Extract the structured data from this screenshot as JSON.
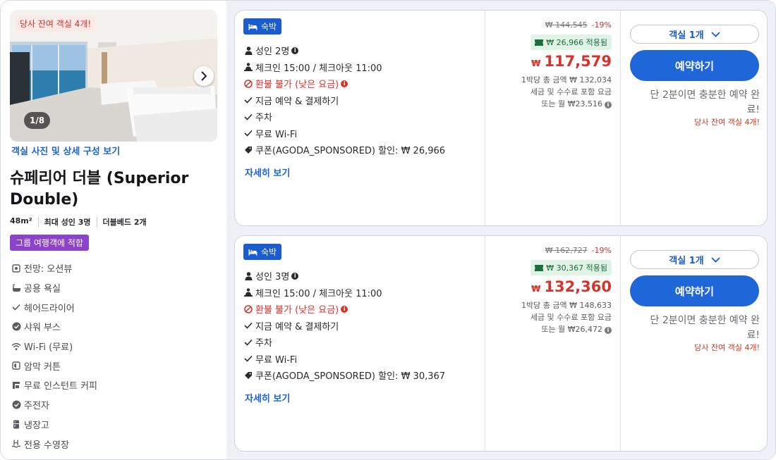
{
  "room": {
    "availability_badge": "당사 잔여 객실 4개!",
    "photo_counter": "1/8",
    "photos_link": "객실 사진 및 상세 구성 보기",
    "title": "슈페리어 더블 (Superior Double)",
    "size": "48m²",
    "max_guests": "최대 성인 3명",
    "beds": "더블베드 2개",
    "group_tag": "그룹 여행객에 적합",
    "amenities": [
      {
        "icon": "view-icon",
        "label": "전망: 오션뷰"
      },
      {
        "icon": "bathtub-icon",
        "label": "공용 욕실"
      },
      {
        "icon": "check-icon",
        "label": "헤어드라이어"
      },
      {
        "icon": "check-circle-icon",
        "label": "샤워 부스"
      },
      {
        "icon": "wifi-icon",
        "label": "Wi-Fi (무료)"
      },
      {
        "icon": "blackout-icon",
        "label": "암막 커튼"
      },
      {
        "icon": "coffee-machine-icon",
        "label": "무료 인스턴트 커피"
      },
      {
        "icon": "check-circle-icon",
        "label": "주전자"
      },
      {
        "icon": "fridge-icon",
        "label": "냉장고"
      },
      {
        "icon": "pool-icon",
        "label": "전용 수영장"
      }
    ]
  },
  "offers": [
    {
      "stay_tag": "숙박",
      "features": {
        "guests": "성인 2명",
        "checkin": "체크인 15:00 / 체크아웃 11:00",
        "refund": "환불 불가 (낮은 요금)",
        "pay_now": "지금 예약 & 결제하기",
        "parking": "주차",
        "wifi": "무료 Wi-Fi",
        "coupon": "쿠폰(AGODA_SPONSORED) 할인: ₩ 26,966"
      },
      "details_link": "자세히 보기",
      "original_price": "₩ 144,545",
      "discount_pct": "-19%",
      "coupon_applied": "₩ 26,966 적용됨",
      "currency": "₩",
      "price": "117,579",
      "total_line": "1박당 총 금액 ₩ 132,034",
      "tax_line": "세금 및 수수료 포함 요금",
      "monthly_line": "또는 월 ₩23,516",
      "room_select": "객실 1개",
      "book_button": "예약하기",
      "booking_note": "단 2분이면 충분한 예약 완료!",
      "availability": "당사 잔여 객실 4개!"
    },
    {
      "stay_tag": "숙박",
      "features": {
        "guests": "성인 3명",
        "checkin": "체크인 15:00 / 체크아웃 11:00",
        "refund": "환불 불가 (낮은 요금)",
        "pay_now": "지금 예약 & 결제하기",
        "parking": "주차",
        "wifi": "무료 Wi-Fi",
        "coupon": "쿠폰(AGODA_SPONSORED) 할인: ₩ 30,367"
      },
      "details_link": "자세히 보기",
      "original_price": "₩ 162,727",
      "discount_pct": "-19%",
      "coupon_applied": "₩ 30,367 적용됨",
      "currency": "₩",
      "price": "132,360",
      "total_line": "1박당 총 금액 ₩ 148,633",
      "tax_line": "세금 및 수수료 포함 요금",
      "monthly_line": "또는 월 ₩26,472",
      "room_select": "객실 1개",
      "book_button": "예약하기",
      "booking_note": "단 2분이면 충분한 예약 완료!",
      "availability": "당사 잔여 객실 4개!"
    }
  ]
}
